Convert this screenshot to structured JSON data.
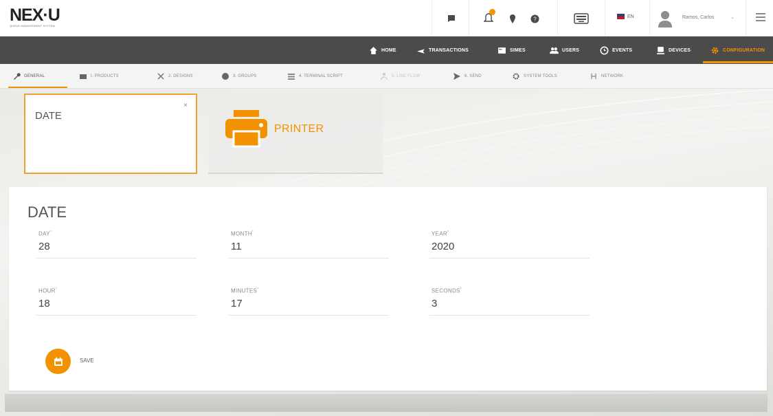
{
  "header": {
    "logo_text": "NEX·U",
    "logo_subtitle": "QUEUE MANAGEMENT SYSTEM",
    "language": "EN",
    "user_name": "Ramos, Carlos"
  },
  "nav": {
    "items": [
      {
        "label": "HOME",
        "icon": "home-icon"
      },
      {
        "label": "TRANSACTIONS",
        "icon": "plane-icon"
      },
      {
        "label": "SIMES",
        "icon": "card-icon"
      },
      {
        "label": "USERS",
        "icon": "users-icon"
      },
      {
        "label": "EVENTS",
        "icon": "clock-icon"
      },
      {
        "label": "DEVICES",
        "icon": "device-icon"
      },
      {
        "label": "CONFIGURATION",
        "icon": "gear-icon"
      }
    ],
    "active": "CONFIGURATION"
  },
  "subtabs": {
    "items": [
      {
        "label": "GENERAL",
        "icon": "wrench-icon"
      },
      {
        "label": "I. PRODUCTS",
        "icon": "products-icon"
      },
      {
        "label": "2. DESIGNS",
        "icon": "designs-icon"
      },
      {
        "label": "3. GROUPS",
        "icon": "groups-icon"
      },
      {
        "label": "4. TERMINAL SCRIPT",
        "icon": "list-icon"
      },
      {
        "label": "5. LINE FLOW",
        "icon": "flow-icon"
      },
      {
        "label": "6. SEND",
        "icon": "send-icon"
      },
      {
        "label": "SYSTEM TOOLS",
        "icon": "tools-icon"
      },
      {
        "label": "NETWORK",
        "icon": "network-icon"
      }
    ],
    "active": "GENERAL"
  },
  "cards": {
    "date_title": "DATE",
    "close_glyph": "×",
    "printer_label": "PRINTER"
  },
  "form": {
    "title": "DATE",
    "required_mark": "*",
    "fields": {
      "day": {
        "label": "DAY",
        "value": "28"
      },
      "month": {
        "label": "MONTH",
        "value": "11"
      },
      "year": {
        "label": "YEAR",
        "value": "2020"
      },
      "hour": {
        "label": "HOUR",
        "value": "18"
      },
      "minutes": {
        "label": "MINUTES",
        "value": "17"
      },
      "seconds": {
        "label": "SECONDS",
        "value": "3"
      }
    },
    "save_label": "SAVE"
  },
  "colors": {
    "accent": "#f39200",
    "nav_bg": "#4b4b4b",
    "panel_bg": "#ffffff"
  }
}
